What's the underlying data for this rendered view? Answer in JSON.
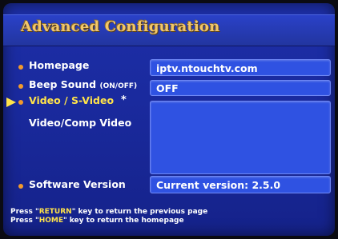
{
  "header": {
    "title": "Advanced Configuration"
  },
  "settings": {
    "homepage": {
      "label": "Homepage",
      "value": "iptv.ntouchtv.com"
    },
    "beep": {
      "label": "Beep Sound",
      "note": "(ON/OFF)",
      "value": "OFF"
    },
    "video_svideo": {
      "label": "Video / S-Video",
      "marker": "*",
      "value": ""
    },
    "video_comp": {
      "label": "Video/Comp Video"
    },
    "software": {
      "label": "Software Version",
      "value": "Current version: 2.5.0"
    }
  },
  "help": {
    "line1": {
      "prefix": "Press \"",
      "key": "RETURN",
      "suffix": "\" key to return the previous page"
    },
    "line2": {
      "prefix": "Press \"",
      "key": "HOME",
      "suffix": "\" key to return the homepage"
    }
  },
  "colors": {
    "background": "#1a2a9e",
    "title": "#f2c76a",
    "field": "#2f52e2",
    "bullet": "#f29a2c",
    "highlight": "#ffe34a"
  },
  "icons": {
    "selection": "arrow-right-icon",
    "bullet": "bullet-dot-icon"
  }
}
